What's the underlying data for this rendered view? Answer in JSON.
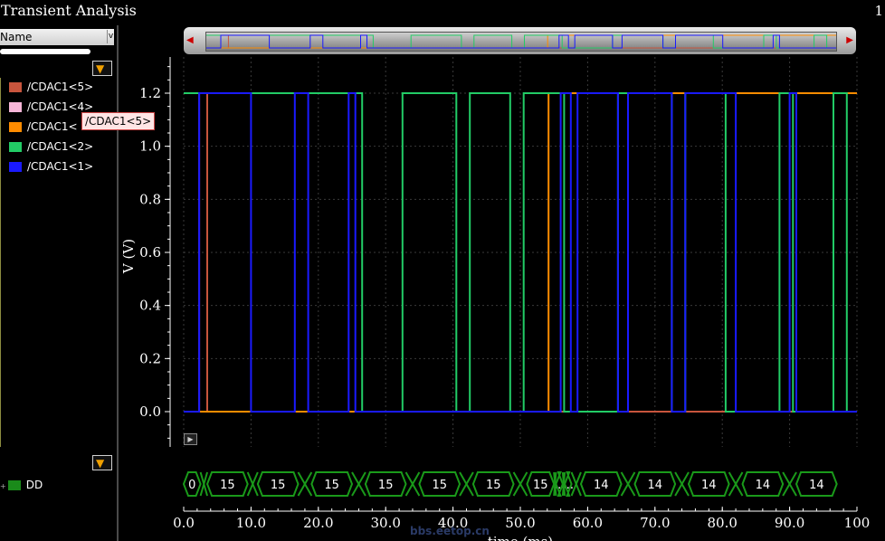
{
  "window": {
    "title": "Transient Analysis",
    "page_indicator": "1"
  },
  "left_panel": {
    "column_header": "Name",
    "signals": [
      {
        "label": "/CDAC1<5>",
        "color": "#c8553d"
      },
      {
        "label": "/CDAC1<4>",
        "color": "#f7b6d8"
      },
      {
        "label": "/CDAC1<",
        "color": "#ff8c00"
      },
      {
        "label": "/CDAC1<2>",
        "color": "#22cc66"
      },
      {
        "label": "/CDAC1<1>",
        "color": "#1a1aff"
      }
    ],
    "bus_signal": {
      "label": "DD",
      "color": "#1a8a1a"
    },
    "tooltip": "/CDAC1<5>"
  },
  "plot": {
    "ylabel": "V (V)",
    "xlabel": "time (ms)",
    "yticks": [
      "1.2",
      "1.0",
      "0.8",
      "0.6",
      "0.4",
      "0.2",
      "0.0"
    ],
    "xticks": [
      "0.0",
      "10.0",
      "20.0",
      "30.0",
      "40.0",
      "50.0",
      "60.0",
      "70.0",
      "80.0",
      "90.0",
      "100"
    ],
    "watermark": "bbs.eetop.cn"
  },
  "chart_data": {
    "type": "line",
    "title": "",
    "xlabel": "time (ms)",
    "ylabel": "V (V)",
    "xlim": [
      0,
      100
    ],
    "ylim": [
      -0.1,
      1.3
    ],
    "series": [
      {
        "name": "/CDAC1<5>",
        "color": "#c8553d",
        "x": [
          0,
          2.3,
          2.3,
          3.5,
          3.5,
          100
        ],
        "y": [
          0,
          0,
          1.2,
          1.2,
          0,
          0
        ]
      },
      {
        "name": "/CDAC1<",
        "color": "#ff8c00",
        "x": [
          0,
          54.2,
          54.2,
          100
        ],
        "y": [
          0,
          0,
          1.2,
          1.2
        ]
      },
      {
        "name": "/CDAC1<2>",
        "color": "#22cc66",
        "x": [
          0,
          26.5,
          26.5,
          32.5,
          32.5,
          40.5,
          40.5,
          42.5,
          42.5,
          48.5,
          48.5,
          50.5,
          50.5,
          56.5,
          56.5,
          64.5,
          64.5,
          72.5,
          72.5,
          74.5,
          74.5,
          80.5,
          80.5,
          88.5,
          88.5,
          90.5,
          90.5,
          96.5,
          96.5,
          98.5,
          98.5,
          100
        ],
        "y": [
          1.2,
          1.2,
          0,
          0,
          1.2,
          1.2,
          0,
          0,
          1.2,
          1.2,
          0,
          0,
          1.2,
          1.2,
          0,
          0,
          1.2,
          1.2,
          0,
          0,
          1.2,
          1.2,
          0,
          0,
          1.2,
          1.2,
          0,
          0,
          1.2,
          1.2,
          0,
          0
        ]
      },
      {
        "name": "/CDAC1<1>",
        "color": "#1a1aff",
        "x": [
          0,
          2.3,
          2.3,
          10.0,
          10.0,
          16.5,
          16.5,
          18.5,
          18.5,
          24.5,
          24.5,
          25.5,
          25.5,
          56.0,
          56.0,
          57.5,
          57.5,
          58.5,
          58.5,
          64.5,
          64.5,
          66.0,
          66.0,
          72.5,
          72.5,
          74.5,
          74.5,
          82.0,
          82.0,
          90.0,
          90.0,
          91.0,
          91.0,
          100
        ],
        "y": [
          0,
          0,
          1.2,
          1.2,
          0,
          0,
          1.2,
          1.2,
          0,
          0,
          1.2,
          1.2,
          0,
          0,
          1.2,
          1.2,
          0,
          0,
          1.2,
          1.2,
          0,
          0,
          1.2,
          1.2,
          0,
          0,
          1.2,
          1.2,
          0,
          0,
          1.2,
          1.2,
          0,
          0
        ]
      }
    ],
    "bus": {
      "name": "DD",
      "segments": [
        {
          "label": "0",
          "start": 0,
          "end": 2.5
        },
        {
          "label": "15",
          "start": 3.5,
          "end": 9.5
        },
        {
          "label": "15",
          "start": 11,
          "end": 17
        },
        {
          "label": "15",
          "start": 19,
          "end": 25
        },
        {
          "label": "15",
          "start": 27,
          "end": 33
        },
        {
          "label": "15",
          "start": 35,
          "end": 41
        },
        {
          "label": "15",
          "start": 43,
          "end": 49
        },
        {
          "label": "15",
          "start": 51,
          "end": 55
        },
        {
          "label": "...",
          "start": 55.3,
          "end": 56.3
        },
        {
          "label": "...",
          "start": 56.6,
          "end": 57.6
        },
        {
          "label": "14",
          "start": 59,
          "end": 65
        },
        {
          "label": "14",
          "start": 67,
          "end": 73
        },
        {
          "label": "14",
          "start": 75,
          "end": 81
        },
        {
          "label": "14",
          "start": 83,
          "end": 89
        },
        {
          "label": "14",
          "start": 91,
          "end": 97
        }
      ]
    }
  }
}
